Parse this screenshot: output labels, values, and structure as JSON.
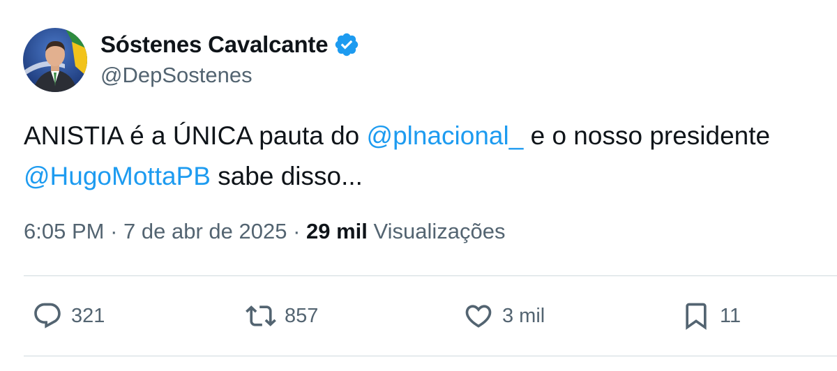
{
  "author": {
    "display_name": "Sóstenes Cavalcante",
    "handle": "@DepSostenes",
    "verified_icon": "verified-badge-icon"
  },
  "tweet": {
    "text_part1": "ANISTIA é a ÚNICA pauta do ",
    "mention1": "@plnacional_",
    "text_part2": " e o nosso presidente ",
    "mention2": "@HugoMottaPB",
    "text_part3": " sabe disso..."
  },
  "meta": {
    "time": "6:05 PM",
    "separator": " · ",
    "date": "7 de abr de 2025",
    "views_count": "29 mil",
    "views_label": "Visualizações"
  },
  "actions": {
    "replies": "321",
    "retweets": "857",
    "likes": "3 mil",
    "bookmarks": "11"
  },
  "colors": {
    "text": "#0f1419",
    "secondary": "#536471",
    "link": "#1d9bf0",
    "divider": "#cfd9de"
  }
}
